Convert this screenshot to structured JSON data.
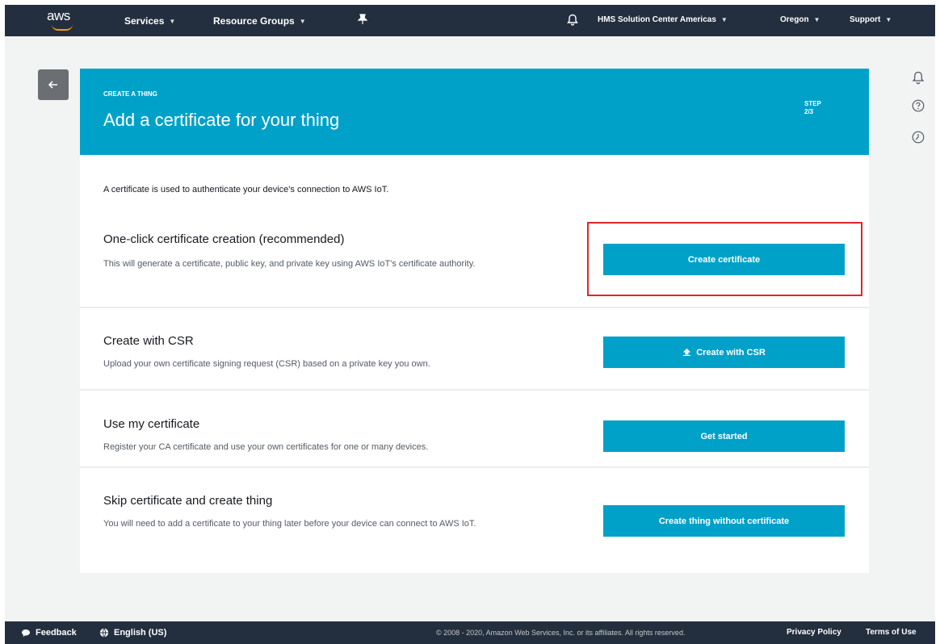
{
  "nav": {
    "logo_text": "aws",
    "services": "Services",
    "resource_groups": "Resource Groups",
    "account": "HMS Solution Center Americas",
    "region": "Oregon",
    "support": "Support"
  },
  "header": {
    "eyebrow": "CREATE A THING",
    "title": "Add a certificate for your thing",
    "step_label": "STEP",
    "step_value": "2/3"
  },
  "intro": "A certificate is used to authenticate your device's connection to AWS IoT.",
  "options": [
    {
      "title": "One-click certificate creation (recommended)",
      "description": "This will generate a certificate, public key, and private key using AWS IoT's certificate authority.",
      "button": "Create certificate"
    },
    {
      "title": "Create with CSR",
      "description": "Upload your own certificate signing request (CSR) based on a private key you own.",
      "button": "Create with CSR"
    },
    {
      "title": "Use my certificate",
      "description": "Register your CA certificate and use your own certificates for one or many devices.",
      "button": "Get started"
    },
    {
      "title": "Skip certificate and create thing",
      "description": "You will need to add a certificate to your thing later before your device can connect to AWS IoT.",
      "button": "Create thing without certificate"
    }
  ],
  "footer": {
    "feedback": "Feedback",
    "language": "English (US)",
    "copyright": "© 2008 - 2020, Amazon Web Services, Inc. or its affiliates. All rights reserved.",
    "privacy": "Privacy Policy",
    "terms": "Terms of Use"
  },
  "colors": {
    "navbar": "#232f3e",
    "accent": "#00a1c9",
    "highlight": "#e0242b",
    "aws_orange": "#ff9900"
  },
  "icons": [
    "bell-icon",
    "pin-icon",
    "back-arrow-icon",
    "help-icon",
    "clock-icon",
    "upload-icon",
    "speech-bubble-icon",
    "globe-icon"
  ]
}
